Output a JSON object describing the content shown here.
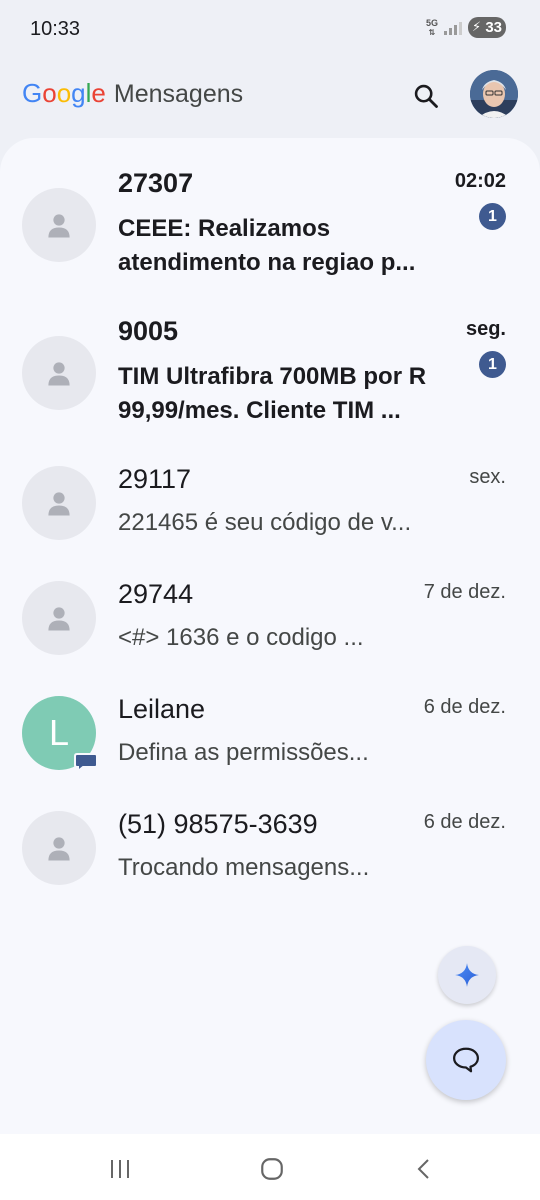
{
  "status_bar": {
    "time": "10:33",
    "network_label": "5G",
    "battery_level": "33"
  },
  "header": {
    "brand_letters": [
      "G",
      "o",
      "o",
      "g",
      "l",
      "e"
    ],
    "app_name": "Mensagens",
    "search_icon": "search-icon",
    "avatar_icon": "account-avatar"
  },
  "conversations": [
    {
      "name": "27307",
      "snippet": "CEEE: Realizamos atendimento na regiao p...",
      "time": "02:02",
      "unread_count": "1",
      "unread": true,
      "avatar": "person-icon"
    },
    {
      "name": "9005",
      "snippet": "TIM Ultrafibra 700MB por R 99,99/mes. Cliente TIM ...",
      "time": "seg.",
      "unread_count": "1",
      "unread": true,
      "avatar": "person-icon"
    },
    {
      "name": "29117",
      "snippet": "221465 é seu código de v...",
      "time": "sex.",
      "unread": false,
      "avatar": "person-icon"
    },
    {
      "name": "29744",
      "snippet": "<#> 1636 e o codigo ...",
      "time": "7 de dez.",
      "unread": false,
      "avatar": "person-icon"
    },
    {
      "name": "Leilane",
      "snippet": "Defina as permissões...",
      "time": "6 de dez.",
      "unread": false,
      "avatar_letter": "L",
      "avatar_color": "#7fcbb4"
    },
    {
      "name": "(51) 98575-3639",
      "snippet": "Trocando mensagens...",
      "time": "6 de dez.",
      "unread": false,
      "avatar": "person-icon"
    }
  ],
  "fabs": {
    "gemini_icon": "sparkle-icon",
    "compose_icon": "chat-bubble-icon"
  },
  "colors": {
    "accent": "#3f5a90",
    "fab_compose": "#d8e2fd",
    "list_background": "#f7f8fd"
  }
}
